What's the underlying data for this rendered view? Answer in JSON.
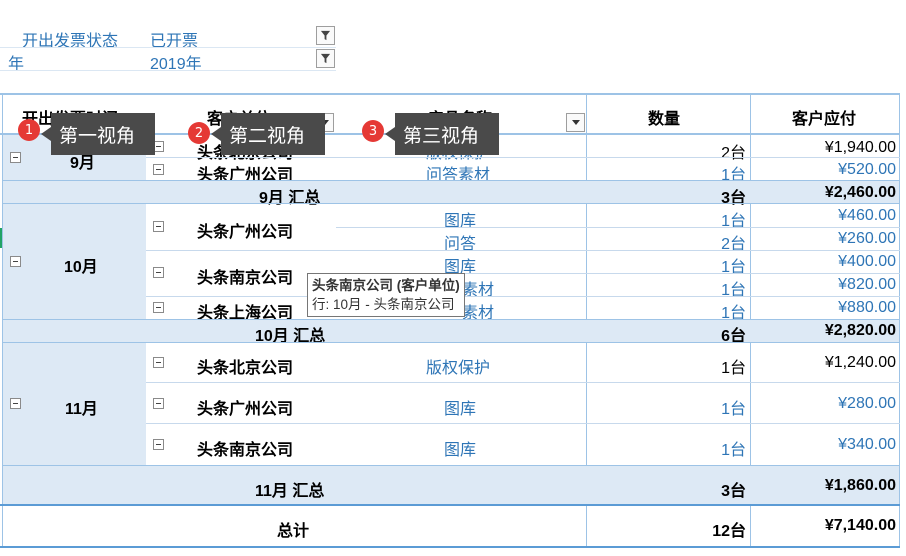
{
  "filters": [
    {
      "label": "开出发票状态",
      "value": "已开票",
      "icon": "filter-icon"
    },
    {
      "label": "年",
      "value": "2019年",
      "icon": "filter-icon"
    }
  ],
  "headers": {
    "col1": "开出发票时间",
    "col2": "客户单位",
    "col3": "产品名称",
    "col4": "数量",
    "col5": "客户应付"
  },
  "callouts": [
    {
      "num": "1",
      "text": "第一视角"
    },
    {
      "num": "2",
      "text": "第二视角"
    },
    {
      "num": "3",
      "text": "第三视角"
    }
  ],
  "months": [
    {
      "label": "9月",
      "customers": [
        {
          "name": "头条北京公司",
          "rows": [
            {
              "product": "版权保护",
              "qty": "2台",
              "amount": "¥1,940.00"
            }
          ]
        },
        {
          "name": "头条广州公司",
          "rows": [
            {
              "product": "问答素材",
              "qty": "1台",
              "amount": "¥520.00"
            }
          ]
        }
      ],
      "subtotal": {
        "label": "9月 汇总",
        "qty": "3台",
        "amount": "¥2,460.00"
      }
    },
    {
      "label": "10月",
      "customers": [
        {
          "name": "头条广州公司",
          "rows": [
            {
              "product": "图库",
              "qty": "1台",
              "amount": "¥460.00"
            },
            {
              "product": "问答",
              "qty": "2台",
              "amount": "¥260.00"
            }
          ]
        },
        {
          "name": "头条南京公司",
          "rows": [
            {
              "product": "图库",
              "qty": "1台",
              "amount": "¥400.00"
            },
            {
              "product": "素材",
              "qty": "1台",
              "amount": "¥820.00"
            }
          ]
        },
        {
          "name": "头条上海公司",
          "rows": [
            {
              "product": "素材",
              "qty": "1台",
              "amount": "¥880.00"
            }
          ]
        }
      ],
      "subtotal": {
        "label": "10月 汇总",
        "qty": "6台",
        "amount": "¥2,820.00"
      }
    },
    {
      "label": "11月",
      "customers": [
        {
          "name": "头条北京公司",
          "rows": [
            {
              "product": "版权保护",
              "qty": "1台",
              "amount": "¥1,240.00"
            }
          ]
        },
        {
          "name": "头条广州公司",
          "rows": [
            {
              "product": "图库",
              "qty": "1台",
              "amount": "¥280.00"
            }
          ]
        },
        {
          "name": "头条南京公司",
          "rows": [
            {
              "product": "图库",
              "qty": "1台",
              "amount": "¥340.00"
            }
          ]
        }
      ],
      "subtotal": {
        "label": "11月 汇总",
        "qty": "3台",
        "amount": "¥1,860.00"
      }
    }
  ],
  "grand_total": {
    "label": "总计",
    "qty": "12台",
    "amount": "¥7,140.00"
  },
  "tooltip": {
    "title": "头条南京公司 (客户单位)",
    "detail": "行: 10月 - 头条南京公司"
  },
  "colors": {
    "accent_blue": "#2e75b6",
    "band": "#dde9f5",
    "badge_red": "#e53935",
    "callout_bg": "#4a4a4a"
  }
}
